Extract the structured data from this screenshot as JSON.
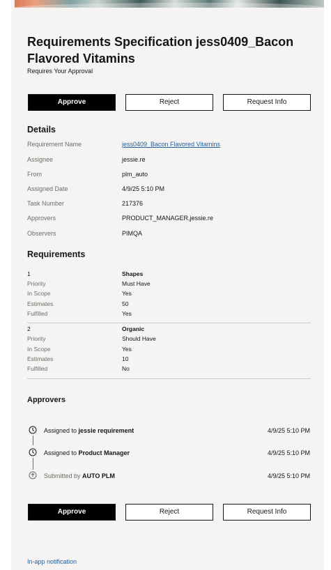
{
  "header": {
    "title": "Requirements Specification jess0409_Bacon Flavored Vitamins",
    "subtitle": "Requires Your Approval"
  },
  "actions": {
    "approve": "Approve",
    "reject": "Reject",
    "request_info": "Request Info"
  },
  "details": {
    "heading": "Details",
    "rows": [
      {
        "label": "Requirement Name",
        "value": "jess0409_Bacon Flavored Vitamins"
      },
      {
        "label": "Assignee",
        "value": "jessie.re"
      },
      {
        "label": "From",
        "value": "plm_auto"
      },
      {
        "label": "Assigned Date",
        "value": "4/9/25 5:10 PM"
      },
      {
        "label": "Task Number",
        "value": "217376"
      },
      {
        "label": "Approvers",
        "value": "PRODUCT_MANAGER,jessie.re"
      },
      {
        "label": "Observers",
        "value": "PIMQA"
      }
    ]
  },
  "requirements": {
    "heading": "Requirements",
    "items": [
      {
        "number": "1",
        "name": "Shapes",
        "fields": [
          {
            "label": "Priority",
            "value": "Must Have"
          },
          {
            "label": "In Scope",
            "value": "Yes"
          },
          {
            "label": "Estimates",
            "value": "50"
          },
          {
            "label": "Fulfilled",
            "value": "Yes"
          }
        ]
      },
      {
        "number": "2",
        "name": "Organic",
        "fields": [
          {
            "label": "Priority",
            "value": "Should Have"
          },
          {
            "label": "In Scope",
            "value": "Yes"
          },
          {
            "label": "Estimates",
            "value": "10"
          },
          {
            "label": "Fulfilled",
            "value": "No"
          }
        ]
      }
    ]
  },
  "approvers": {
    "heading": "Approvers",
    "timeline": [
      {
        "icon": "clock-icon",
        "prefix": "Assigned to",
        "who": "jessie requirement",
        "date": "4/9/25 5:10 PM"
      },
      {
        "icon": "clock-icon",
        "prefix": "Assigned to",
        "who": "Product Manager",
        "date": "4/9/25 5:10 PM"
      },
      {
        "icon": "arrow-up-circle-icon",
        "prefix": "Submitted by",
        "who": "AUTO PLM",
        "date": "4/9/25 5:10 PM"
      }
    ]
  },
  "footer": {
    "link": "In-app notification"
  },
  "colors": {
    "card_background": "#f5f4f2",
    "primary_button": "#000000",
    "link": "#1f5e9c",
    "muted_text": "#6f6c69"
  }
}
